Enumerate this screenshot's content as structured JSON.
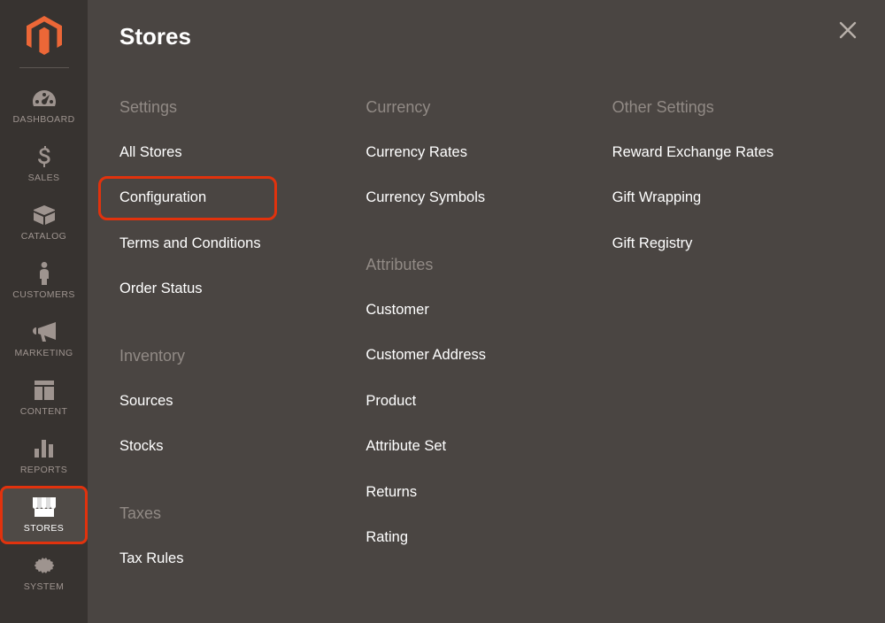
{
  "flyout": {
    "title": "Stores"
  },
  "nav": {
    "items": [
      {
        "key": "dashboard",
        "label": "DASHBOARD"
      },
      {
        "key": "sales",
        "label": "SALES"
      },
      {
        "key": "catalog",
        "label": "CATALOG"
      },
      {
        "key": "customers",
        "label": "CUSTOMERS"
      },
      {
        "key": "marketing",
        "label": "MARKETING"
      },
      {
        "key": "content",
        "label": "CONTENT"
      },
      {
        "key": "reports",
        "label": "REPORTS"
      },
      {
        "key": "stores",
        "label": "STORES"
      },
      {
        "key": "system",
        "label": "SYSTEM"
      }
    ]
  },
  "sections": {
    "settings": {
      "head": "Settings",
      "items": [
        "All Stores",
        "Configuration",
        "Terms and Conditions",
        "Order Status"
      ]
    },
    "inventory": {
      "head": "Inventory",
      "items": [
        "Sources",
        "Stocks"
      ]
    },
    "taxes": {
      "head": "Taxes",
      "items": [
        "Tax Rules"
      ]
    },
    "currency": {
      "head": "Currency",
      "items": [
        "Currency Rates",
        "Currency Symbols"
      ]
    },
    "attributes": {
      "head": "Attributes",
      "items": [
        "Customer",
        "Customer Address",
        "Product",
        "Attribute Set",
        "Returns",
        "Rating"
      ]
    },
    "other": {
      "head": "Other Settings",
      "items": [
        "Reward Exchange Rates",
        "Gift Wrapping",
        "Gift Registry"
      ]
    }
  },
  "highlight": {
    "nav_key": "stores",
    "menu_path": "settings.1"
  }
}
